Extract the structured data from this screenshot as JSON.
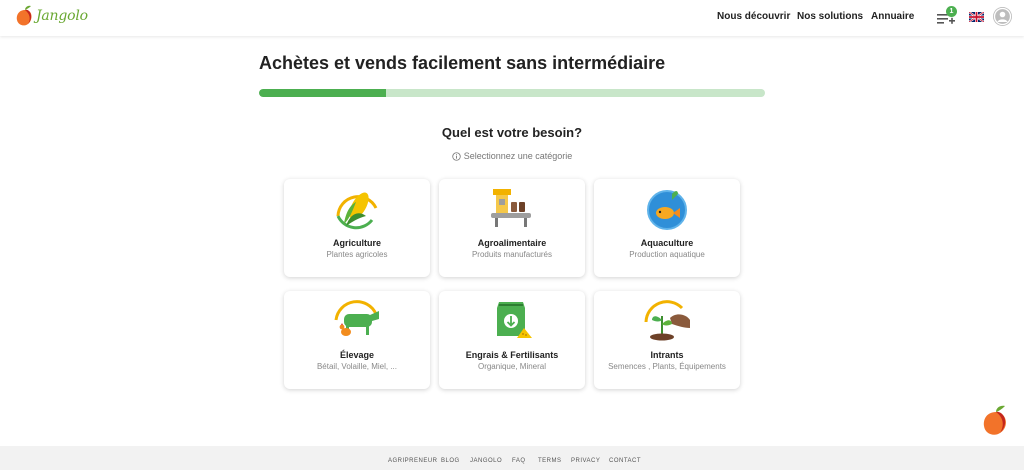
{
  "header": {
    "logo_text": "Jangolo",
    "nav": [
      "Nous découvrir",
      "Nos solutions",
      "Annuaire"
    ],
    "notification_count": "1",
    "language_flag": "uk-flag-icon",
    "avatar_icon": "user-avatar-icon"
  },
  "main": {
    "title": "Achètes et vends facilement sans intermédiaire",
    "progress": 0.25,
    "question": "Quel est votre besoin?",
    "hint": "Selectionnez une catégorie",
    "categories": [
      {
        "title": "Agriculture",
        "subtitle": "Plantes agricoles",
        "icon": "corn-icon"
      },
      {
        "title": "Agroalimentaire",
        "subtitle": "Produits manufacturés",
        "icon": "factory-conveyor-icon"
      },
      {
        "title": "Aquaculture",
        "subtitle": "Production aquatique",
        "icon": "fish-icon"
      },
      {
        "title": "Élevage",
        "subtitle": "Bétail, Volaille, Miel, ...",
        "icon": "cow-chicken-icon"
      },
      {
        "title": "Engrais & Fertilisants",
        "subtitle": "Organique, Mineral",
        "icon": "fertilizer-bag-icon"
      },
      {
        "title": "Intrants",
        "subtitle": "Semences , Plants, Équipements",
        "icon": "seedling-hand-icon"
      }
    ]
  },
  "footer": {
    "links": [
      "AGRIPRENEUR",
      "BLOG",
      "JANGOLO",
      "FAQ",
      "TERMS",
      "PRIVACY",
      "CONTACT"
    ]
  },
  "colors": {
    "accent": "#4caf50",
    "accent_light": "#c8e6c9",
    "logo_orange": "#f2732a",
    "logo_green": "#6aa832"
  }
}
